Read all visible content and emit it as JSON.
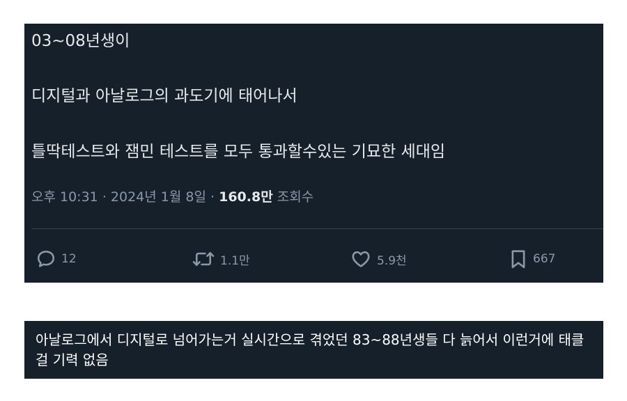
{
  "tweet": {
    "line1": "03~08년생이",
    "line2": "디지털과 아날로그의 과도기에 태어나서",
    "line3": "틀딱테스트와 잼민 테스트를 모두 통과할수있는 기묘한 세대임",
    "time": "오후 10:31",
    "sep": "·",
    "date": "2024년 1월 8일",
    "views_count": "160.8만",
    "views_label": "조회수",
    "replies": "12",
    "retweets": "1.1만",
    "likes": "5.9천",
    "bookmarks": "667"
  },
  "comment": {
    "text": "아날로그에서 디지털로 넘어가는거 실시간으로 겪었던 83~88년생들 다 늙어서 이런거에 태클 걸 기력 없음"
  },
  "colors": {
    "card_bg": "#15202b",
    "text_primary": "#e7e9ea",
    "text_secondary": "#8b98a5",
    "divider": "#38444d"
  },
  "icons": {
    "reply": "speech-bubble-icon",
    "retweet": "retweet-arrows-icon",
    "like": "heart-icon",
    "bookmark": "bookmark-icon"
  }
}
